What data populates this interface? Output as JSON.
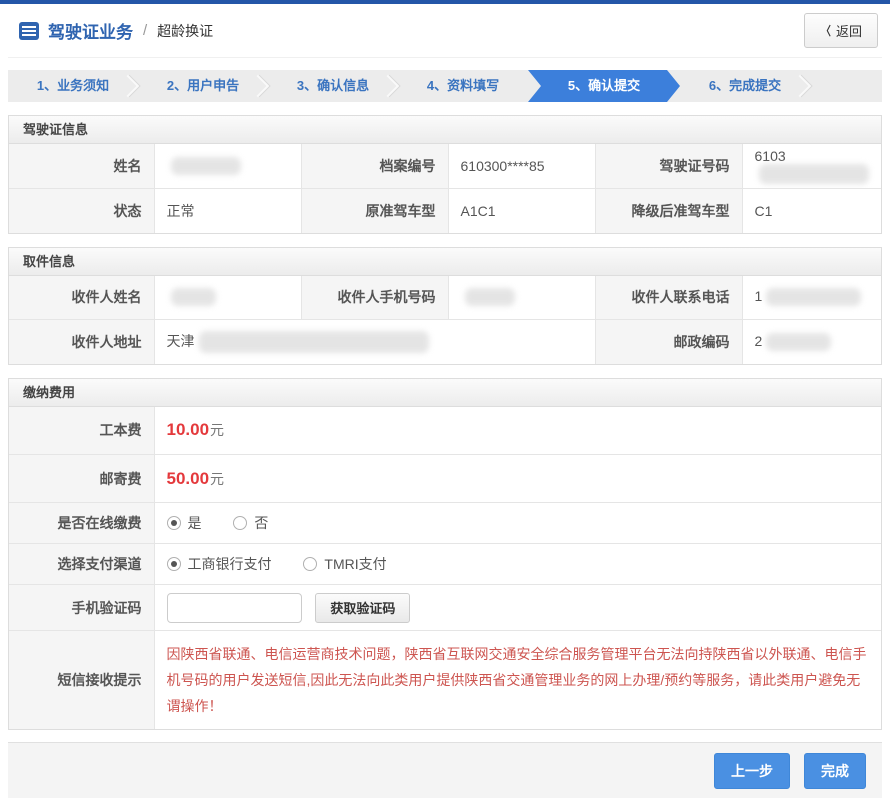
{
  "header": {
    "title": "驾驶证业务",
    "separator": "/",
    "subtitle": "超龄换证",
    "back_chevron": "〈",
    "back_label": "返回"
  },
  "stepper": {
    "steps": [
      {
        "label": "1、业务须知",
        "active": false
      },
      {
        "label": "2、用户申告",
        "active": false
      },
      {
        "label": "3、确认信息",
        "active": false
      },
      {
        "label": "4、资料填写",
        "active": false
      },
      {
        "label": "5、确认提交",
        "active": true
      },
      {
        "label": "6、完成提交",
        "active": false
      }
    ]
  },
  "license_info": {
    "title": "驾驶证信息",
    "rows": [
      {
        "c0l": "姓名",
        "c0v": "",
        "c1l": "档案编号",
        "c1v": "610300****85",
        "c2l": "驾驶证号码",
        "c2v": "6103"
      },
      {
        "c0l": "状态",
        "c0v": "正常",
        "c1l": "原准驾车型",
        "c1v": "A1C1",
        "c2l": "降级后准驾车型",
        "c2v": "C1"
      }
    ]
  },
  "pickup_info": {
    "title": "取件信息",
    "row1": {
      "c0l": "收件人姓名",
      "c0v": "",
      "c1l": "收件人手机号码",
      "c1v": "",
      "c2l": "收件人联系电话",
      "c2v": "1"
    },
    "row2": {
      "c0l": "收件人地址",
      "c0v": "天津",
      "c1l": "邮政编码",
      "c1v": "2"
    }
  },
  "payment": {
    "title": "缴纳费用",
    "fee1_label": "工本费",
    "fee1_value": "10.00",
    "fee1_unit": "元",
    "fee2_label": "邮寄费",
    "fee2_value": "50.00",
    "fee2_unit": "元",
    "online_label": "是否在线缴费",
    "online_yes": "是",
    "online_no": "否",
    "channel_label": "选择支付渠道",
    "channel_1": "工商银行支付",
    "channel_2": "TMRI支付",
    "captcha_label": "手机验证码",
    "captcha_value": "",
    "captcha_button": "获取验证码",
    "notice_label": "短信接收提示",
    "notice_text": "因陕西省联通、电信运营商技术问题，陕西省互联网交通安全综合服务管理平台无法向持陕西省以外联通、电信手机号码的用户发送短信,因此无法向此类用户提供陕西省交通管理业务的网上办理/预约等服务，请此类用户避免无谓操作！"
  },
  "footer": {
    "prev": "上一步",
    "finish": "完成"
  },
  "colors": {
    "top_bar": "#2456a8",
    "brand_blue": "#2f64b0",
    "step_active_bg": "#3c7fdb",
    "button_blue": "#4a90e2",
    "fee_red": "#e4393c",
    "notice_red": "#cd5550"
  }
}
